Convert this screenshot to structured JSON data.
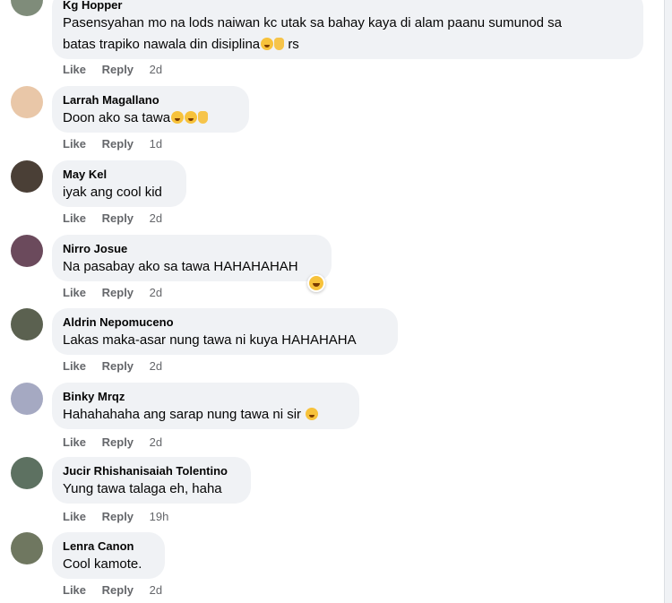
{
  "actions": {
    "like": "Like",
    "reply": "Reply"
  },
  "comments": [
    {
      "author": "Kg Hopper",
      "lines": [
        "Pasensyahan mo na lods naiwan kc utak sa bahay kaya di alam paanu sumunod sa",
        "batas trapiko nawala din disiplina"
      ],
      "line2_suffix": "rs",
      "time": "2d",
      "avatar_color": "#7f8c7a"
    },
    {
      "author": "Larrah Magallano",
      "text": "Doon ako sa tawa",
      "time": "1d",
      "avatar_color": "#e9c7a8"
    },
    {
      "author": "May Kel",
      "text": "iyak ang cool kid",
      "time": "2d",
      "avatar_color": "#4a3f36"
    },
    {
      "author": "Nirro Josue",
      "text": "Na pasabay ako sa tawa HAHAHAHAH",
      "time": "2d",
      "avatar_color": "#6b4a5c"
    },
    {
      "author": "Aldrin Nepomuceno",
      "text": "Lakas maka-asar nung tawa ni kuya HAHAHAHA",
      "time": "2d",
      "avatar_color": "#5b6150"
    },
    {
      "author": "Binky Mrqz",
      "text": "Hahahahaha ang sarap nung tawa ni sir",
      "time": "2d",
      "avatar_color": "#a5a9c2"
    },
    {
      "author": "Jucir Rhishanisaiah Tolentino",
      "text": "Yung tawa talaga eh, haha",
      "time": "19h",
      "avatar_color": "#5d7161"
    },
    {
      "author": "Lenra Canon",
      "text": "Cool kamote.",
      "time": "2d",
      "avatar_color": "#6f7760"
    }
  ],
  "icons": {
    "emoji": "emoji-icon",
    "reaction": "haha-reaction-icon"
  }
}
